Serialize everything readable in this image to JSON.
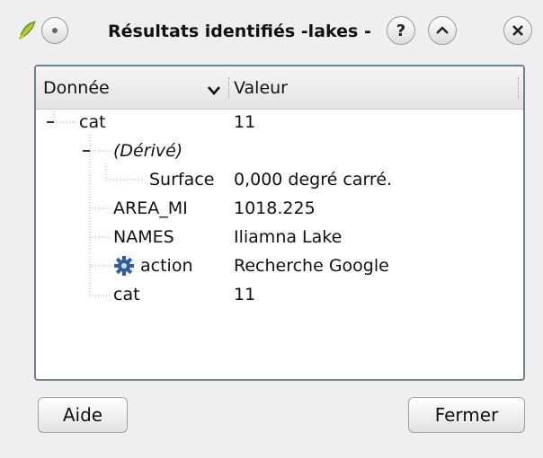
{
  "window": {
    "title": "Résultats identifiés -lakes -"
  },
  "icons": {
    "app": "qgis-icon",
    "menu": "window-menu-icon",
    "help": "help-icon",
    "shade": "shade-up-icon",
    "close": "close-icon",
    "action": "gear-icon"
  },
  "table": {
    "columns": [
      "Donnée",
      "Valeur"
    ],
    "rows": [
      {
        "field": "cat",
        "value": "11"
      },
      {
        "field": "(Dérivé)",
        "value": ""
      },
      {
        "field": "Surface",
        "value": "0,000 degré carré."
      },
      {
        "field": "AREA_MI",
        "value": "1018.225"
      },
      {
        "field": "NAMES",
        "value": "Iliamna Lake"
      },
      {
        "field": "action",
        "value": "Recherche Google"
      },
      {
        "field": "cat",
        "value": "11"
      }
    ]
  },
  "buttons": {
    "help": "Aide",
    "close": "Fermer"
  },
  "colors": {
    "window_bg": "#efefef",
    "panel_border": "#6f7f8f",
    "gear_blue": "#2f5f9f"
  }
}
